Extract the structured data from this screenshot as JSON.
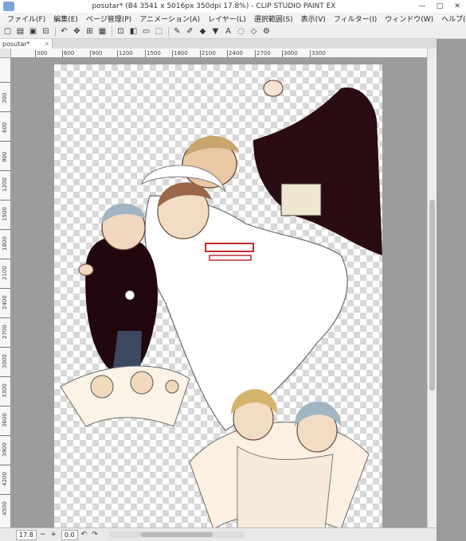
{
  "window": {
    "title": "posutar* (B4 3541 x 5016px 350dpi 17.8%) - CLIP STUDIO PAINT EX",
    "minimize": "—",
    "maximize": "□",
    "close": "✕"
  },
  "menu": [
    "ファイル(F)",
    "編集(E)",
    "ページ管理(P)",
    "アニメーション(A)",
    "レイヤー(L)",
    "選択範囲(S)",
    "表示(V)",
    "フィルター(I)",
    "ウィンドウ(W)",
    "ヘルプ(H)"
  ],
  "toolbar": {
    "icons": [
      "new-icon",
      "open-icon",
      "save-icon",
      "print-icon",
      "undo-icon",
      "move-icon",
      "transform-icon",
      "grid-icon",
      "snap-icon",
      "layer-icon",
      "ruler-icon",
      "select-icon",
      "pen-icon",
      "brush-icon",
      "eraser-icon",
      "fill-icon",
      "text-icon",
      "lasso-icon",
      "shape-icon",
      "settings-icon"
    ],
    "glyphs": [
      "▢",
      "▤",
      "▣",
      "⊟",
      "↶",
      "✥",
      "⊞",
      "▦",
      "⊡",
      "◧",
      "▭",
      "⬚",
      "✎",
      "✐",
      "◆",
      "▼",
      "A",
      "◌",
      "◇",
      "⚙"
    ]
  },
  "tab": {
    "label": "posutar*",
    "close": "×"
  },
  "ruler": {
    "horizontal": [
      "300",
      "600",
      "900",
      "1200",
      "1500",
      "1800",
      "2100",
      "2400",
      "2700",
      "3000",
      "3300"
    ],
    "vertical": [
      "300",
      "600",
      "900",
      "1200",
      "1500",
      "1800",
      "2100",
      "2400",
      "2700",
      "3000",
      "3300",
      "3600",
      "3900",
      "4200",
      "4500"
    ]
  },
  "status": {
    "zoom": "17.8",
    "angle": "0.0",
    "minus": "−",
    "plus": "+",
    "rotate_left": "↶",
    "rotate_right": "↷"
  }
}
